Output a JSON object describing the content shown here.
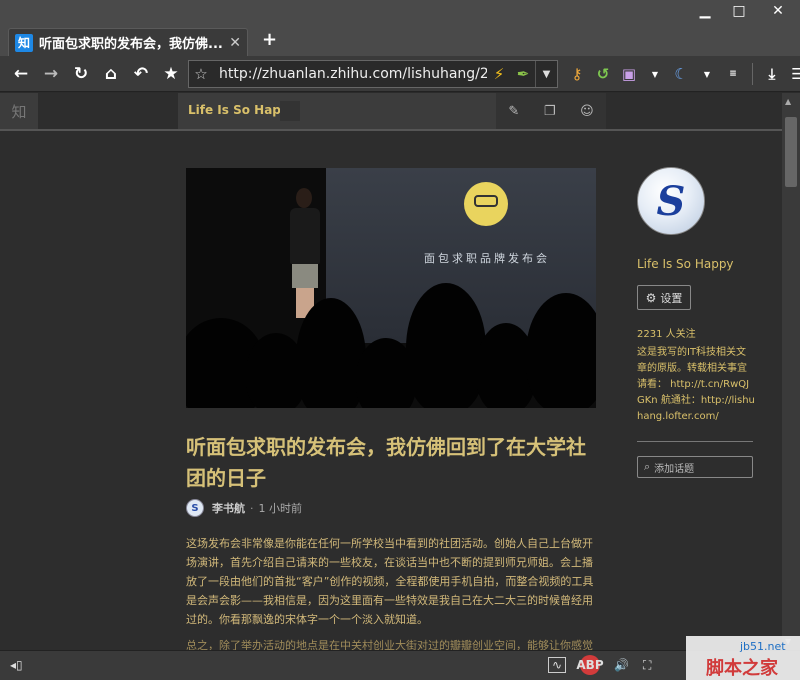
{
  "window": {
    "minimize": "▁",
    "maximize": "□",
    "close": "✕"
  },
  "tab": {
    "favicon": "知",
    "title": "听面包求职的发布会，我仿佛...",
    "close": "✕",
    "new_tab": "+"
  },
  "toolbar": {
    "back_icon": "back-arrow-icon",
    "url": "http://zhuanlan.zhihu.com/lishuhang/20",
    "icons": [
      "back-arrow-icon",
      "forward-arrow-icon",
      "reload-icon",
      "home-icon",
      "undo-icon",
      "star-icon",
      "bookmark-star-icon",
      "lightning-icon",
      "pin-icon",
      "key-icon",
      "user-sync-icon",
      "camera-icon",
      "moon-icon",
      "download-icon",
      "menu-icon"
    ]
  },
  "site_header": {
    "logo": "知",
    "column_name": "Life Is So Happy"
  },
  "article": {
    "hero_caption": "面包求职品牌发布会",
    "title": "听面包求职的发布会，我仿佛回到了在大学社团的日子",
    "author": "李书航",
    "separator": "·",
    "time": "1 小时前",
    "paragraph1": "这场发布会非常像是你能在任何一所学校当中看到的社团活动。创始人自己上台做开场演讲，首先介绍自己请来的一些校友，在谈话当中也不断的提到师兄师姐。会上播放了一段由他们的首批“客户”创作的视频，全程都使用手机自拍，而整合视频的工具是会声会影——我相信是，因为这里面有一些特效是我自己在大二大三的时候曾经用过的。你看那飘逸的宋体字一个一个淡入就知道。",
    "paragraph2": "总之，除了举办活动的地点是在中关村创业大街对过的瓣瓣创业空间，能够让你感觉"
  },
  "sidebar": {
    "avatar_mark": "S",
    "name": "Life Is So Happy",
    "settings_label": "设置",
    "followers": "2231 人关注",
    "description": "这是我写的IT科技相关文章的原版。转载相关事宜请看：  http://t.cn/RwQJGKn 航通社：http://lishuhang.lofter.com/",
    "topic_placeholder": "添加话题"
  },
  "statusbar": {
    "left_icon": "◂▯",
    "abp": "ABP"
  },
  "watermark": {
    "url": "jb51.net",
    "site": "脚本之家"
  },
  "colors": {
    "accent_gold": "#d6c178",
    "background": "#2d2d2d",
    "chrome": "#3a3a3a"
  }
}
